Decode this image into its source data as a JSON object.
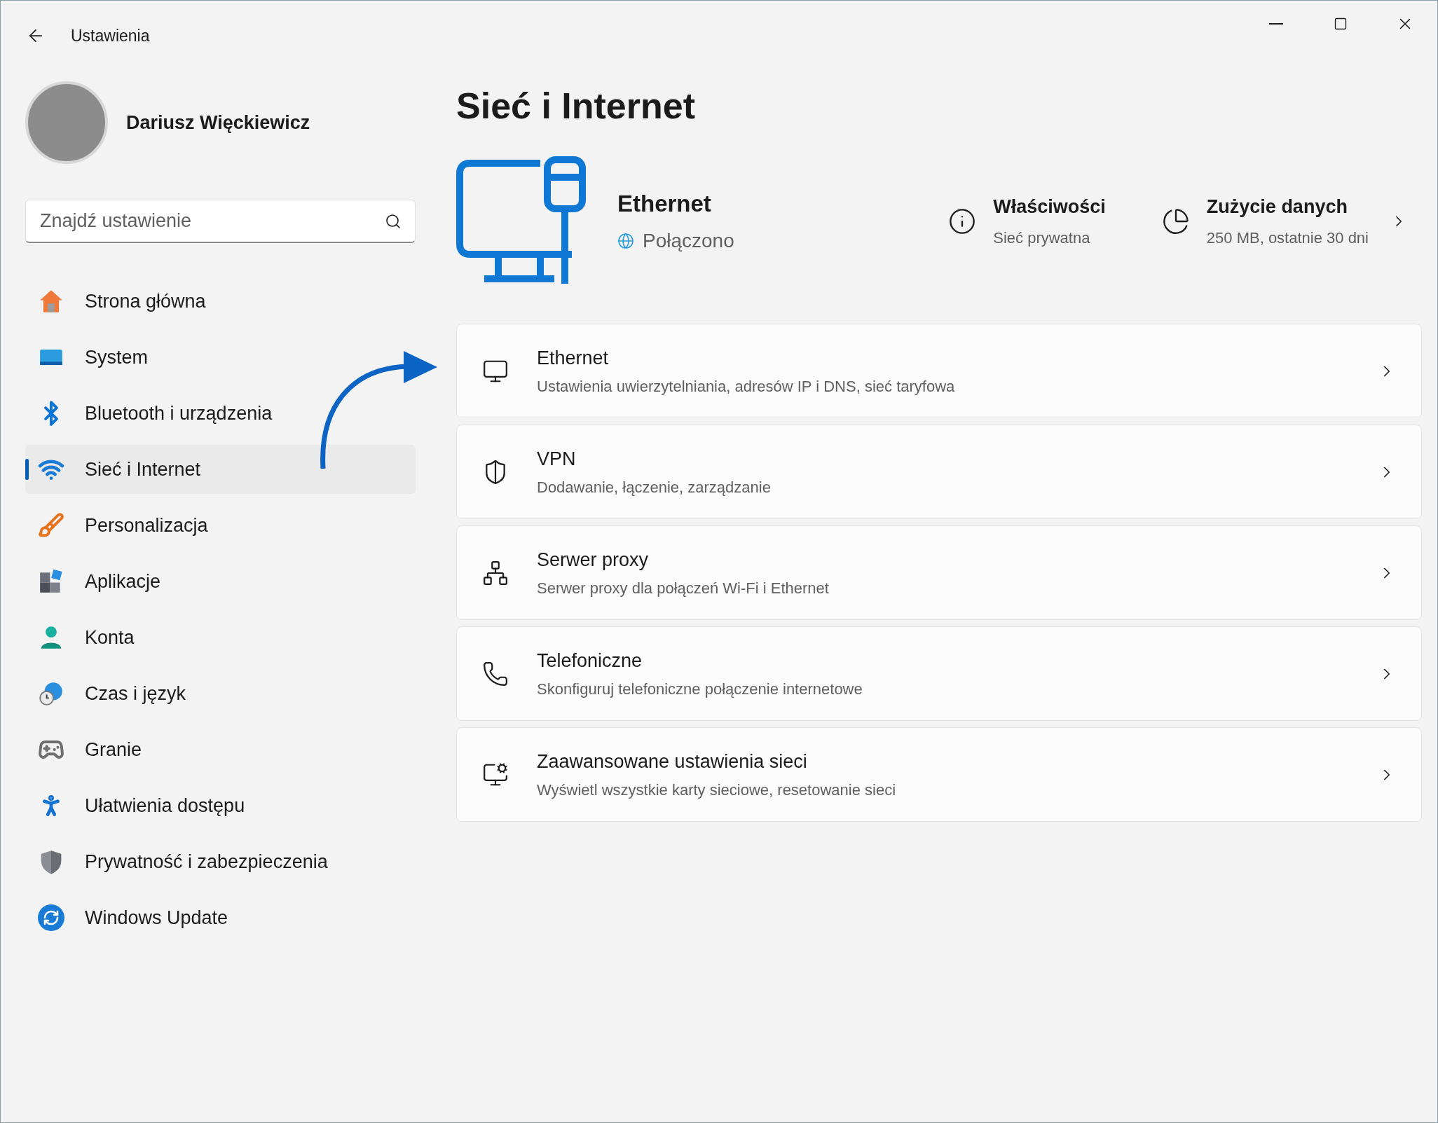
{
  "window": {
    "title": "Ustawienia"
  },
  "profile": {
    "name": "Dariusz Więckiewicz"
  },
  "search": {
    "placeholder": "Znajdź ustawienie"
  },
  "sidebar": {
    "items": [
      {
        "label": "Strona główna",
        "kind": "home",
        "selected": false
      },
      {
        "label": "System",
        "kind": "system",
        "selected": false
      },
      {
        "label": "Bluetooth i urządzenia",
        "kind": "bluetooth",
        "selected": false
      },
      {
        "label": "Sieć i Internet",
        "kind": "network",
        "selected": true
      },
      {
        "label": "Personalizacja",
        "kind": "brush",
        "selected": false
      },
      {
        "label": "Aplikacje",
        "kind": "apps",
        "selected": false
      },
      {
        "label": "Konta",
        "kind": "account",
        "selected": false
      },
      {
        "label": "Czas i język",
        "kind": "time",
        "selected": false
      },
      {
        "label": "Granie",
        "kind": "gaming",
        "selected": false
      },
      {
        "label": "Ułatwienia dostępu",
        "kind": "accessibility",
        "selected": false
      },
      {
        "label": "Prywatność i zabezpieczenia",
        "kind": "privacy",
        "selected": false
      },
      {
        "label": "Windows Update",
        "kind": "update",
        "selected": false
      }
    ]
  },
  "page": {
    "title": "Sieć i Internet"
  },
  "connection": {
    "name": "Ethernet",
    "status": "Połączono"
  },
  "properties": {
    "title": "Właściwości",
    "subtitle": "Sieć prywatna"
  },
  "data_usage": {
    "title": "Zużycie danych",
    "subtitle": "250 MB, ostatnie 30 dni"
  },
  "cards": [
    {
      "kind": "ethernet",
      "title": "Ethernet",
      "subtitle": "Ustawienia uwierzytelniania, adresów IP i DNS, sieć taryfowa"
    },
    {
      "kind": "vpn",
      "title": "VPN",
      "subtitle": "Dodawanie, łączenie, zarządzanie"
    },
    {
      "kind": "proxy",
      "title": "Serwer proxy",
      "subtitle": "Serwer proxy dla połączeń Wi-Fi i Ethernet"
    },
    {
      "kind": "dialup",
      "title": "Telefoniczne",
      "subtitle": "Skonfiguruj telefoniczne połączenie internetowe"
    },
    {
      "kind": "advanced",
      "title": "Zaawansowane ustawienia sieci",
      "subtitle": "Wyświetl wszystkie karty sieciowe, resetowanie sieci"
    }
  ]
}
